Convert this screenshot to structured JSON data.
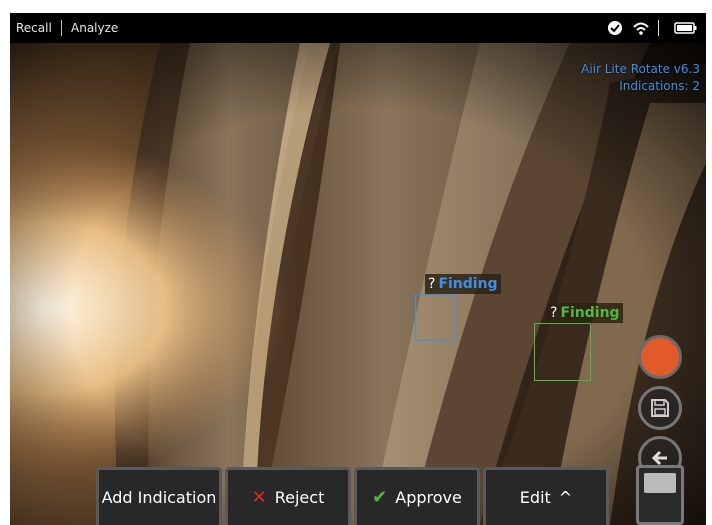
{
  "topbar": {
    "tabs": [
      "Recall",
      "Analyze"
    ],
    "icons": [
      "camera-sync-icon",
      "wifi-icon",
      "battery-icon"
    ]
  },
  "overlay": {
    "software": "Aiir Lite Rotate v6.3",
    "indications": "Indications: 2"
  },
  "findings": [
    {
      "label": "Finding",
      "symbol": "?",
      "color": "#3e8ee6"
    },
    {
      "label": "Finding",
      "symbol": "?",
      "color": "#4fb83f"
    }
  ],
  "toolbar": {
    "add_indication": "Add Indication",
    "reject": "Reject",
    "approve": "Approve",
    "edit": "Edit",
    "edit_arrow": "^",
    "reject_icon": "✕",
    "approve_icon": "✔"
  },
  "side_controls": {
    "record_color": "#e05a2a"
  },
  "colors": {
    "reject": "#e02b20",
    "approve": "#4fb83f",
    "info": "#3e8ee6"
  }
}
